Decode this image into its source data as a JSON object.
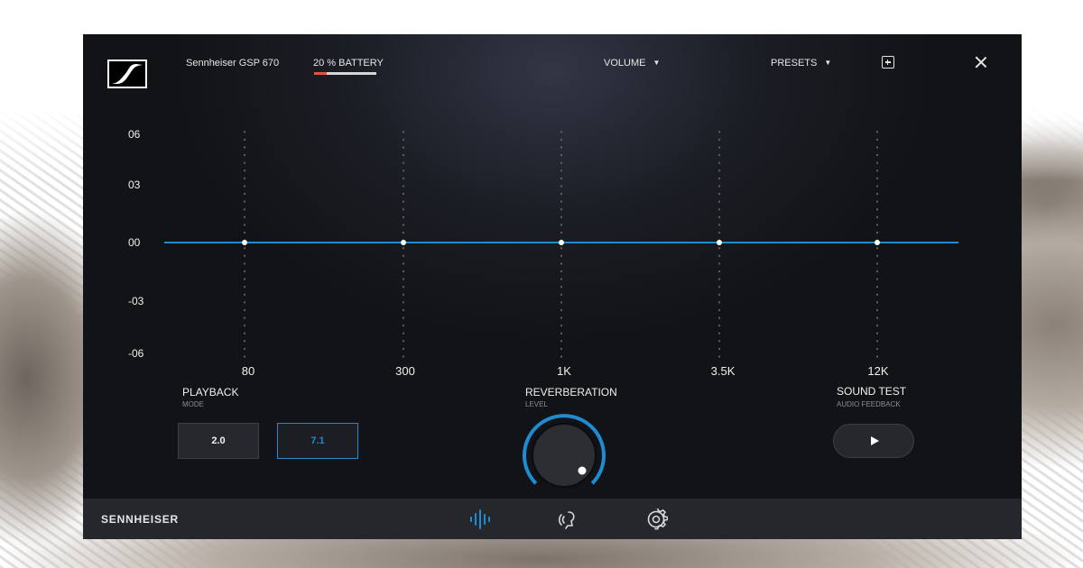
{
  "header": {
    "device_name": "Sennheiser GSP 670",
    "battery_label": "20 % BATTERY",
    "battery_level": 0.2,
    "volume_label": "VOLUME",
    "presets_label": "PRESETS"
  },
  "equalizer": {
    "y_labels": [
      "06",
      "03",
      "00",
      "-03",
      "-06"
    ],
    "bands": [
      {
        "freq": "80",
        "gain": 0
      },
      {
        "freq": "300",
        "gain": 0
      },
      {
        "freq": "1K",
        "gain": 0
      },
      {
        "freq": "3.5K",
        "gain": 0
      },
      {
        "freq": "12K",
        "gain": 0
      }
    ],
    "line_color": "#1f8bd0"
  },
  "playback": {
    "title": "PLAYBACK",
    "subtitle": "MODE",
    "options": [
      "2.0",
      "7.1"
    ],
    "selected": "7.1"
  },
  "reverberation": {
    "title": "REVERBERATION",
    "subtitle": "LEVEL",
    "accent": "#1f8bd0"
  },
  "sound_test": {
    "title": "SOUND TEST",
    "subtitle": "AUDIO FEEDBACK"
  },
  "footer": {
    "brand": "SENNHEISER",
    "nav": [
      "equalizer-icon",
      "voice-icon",
      "gear-icon"
    ],
    "active_nav": "equalizer-icon"
  }
}
